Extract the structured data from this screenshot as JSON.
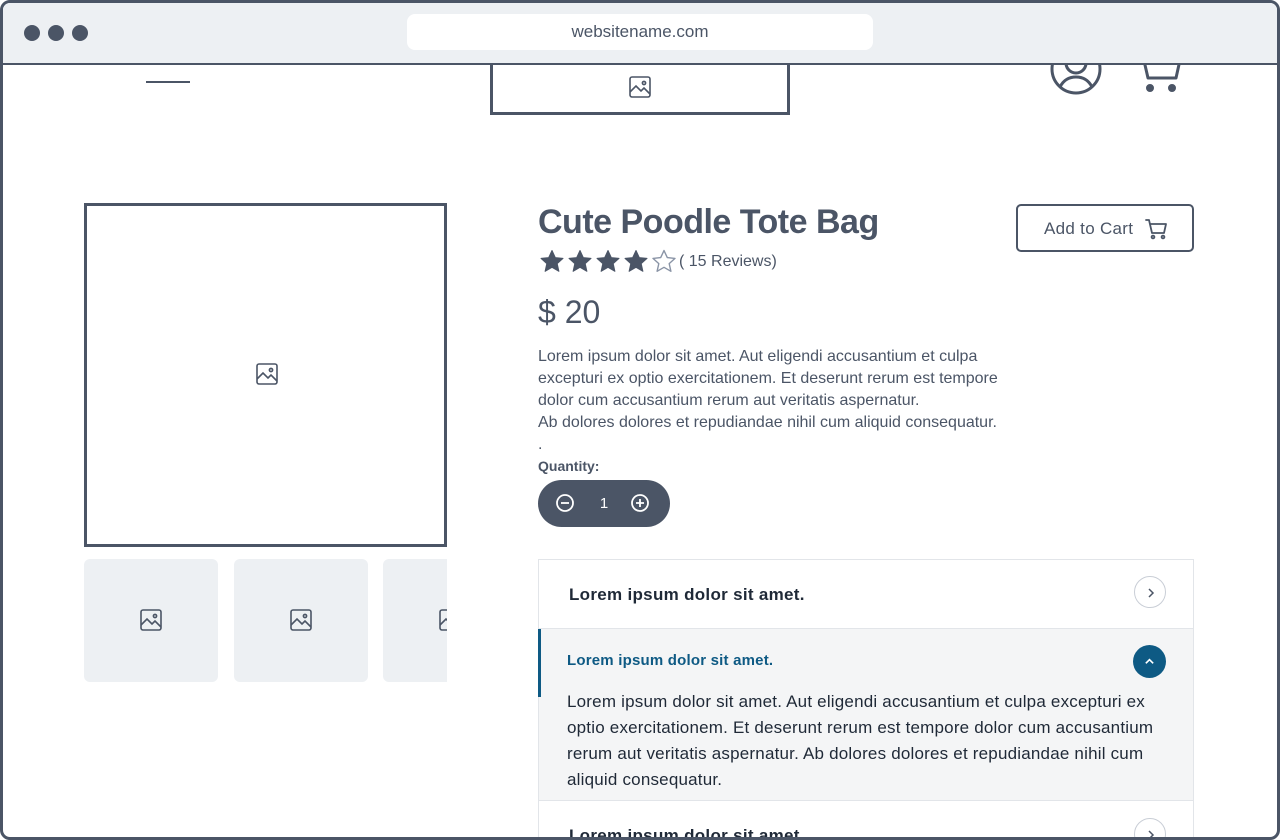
{
  "browser": {
    "url": "websitename.com",
    "window_dots": 3
  },
  "header": {
    "menu_icon": "hamburger-menu-icon",
    "logo_icon": "image-placeholder-icon",
    "account_icon": "user-circle-icon",
    "cart_icon": "shopping-cart-icon"
  },
  "gallery": {
    "main_image_icon": "image-placeholder-icon",
    "thumbnails": [
      {
        "icon": "image-placeholder-icon"
      },
      {
        "icon": "image-placeholder-icon"
      },
      {
        "icon": "image-placeholder-icon"
      }
    ]
  },
  "product": {
    "title": "Cute Poodle Tote Bag",
    "rating": 4,
    "rating_max": 5,
    "reviews_text": "( 15 Reviews)",
    "price": "$ 20",
    "description": [
      "Lorem ipsum dolor sit amet. Aut eligendi accusantium et culpa excepturi ex optio exercitationem. Et deserunt rerum est tempore dolor cum accusantium rerum aut veritatis aspernatur.",
      "Ab dolores dolores et repudiandae nihil cum aliquid consequatur.",
      "."
    ],
    "quantity_label": "Quantity:",
    "quantity_value": "1",
    "add_to_cart_label": "Add to Cart"
  },
  "accordion": {
    "items": [
      {
        "title": "Lorem ipsum dolor sit amet.",
        "expanded": false
      },
      {
        "title": "Lorem ipsum dolor sit amet.",
        "expanded": true,
        "body": "Lorem ipsum dolor sit amet. Aut eligendi accusantium et culpa excepturi ex optio exercitationem. Et deserunt rerum est tempore dolor cum accusantium rerum aut veritatis aspernatur. Ab dolores dolores et repudiandae nihil cum aliquid consequatur."
      },
      {
        "title": "Lorem ipsum dolor sit amet.",
        "expanded": false
      }
    ]
  },
  "colors": {
    "primary": "#4b5566",
    "accent": "#0e5a84",
    "surface": "#edf0f3",
    "panel": "#f4f5f6"
  }
}
